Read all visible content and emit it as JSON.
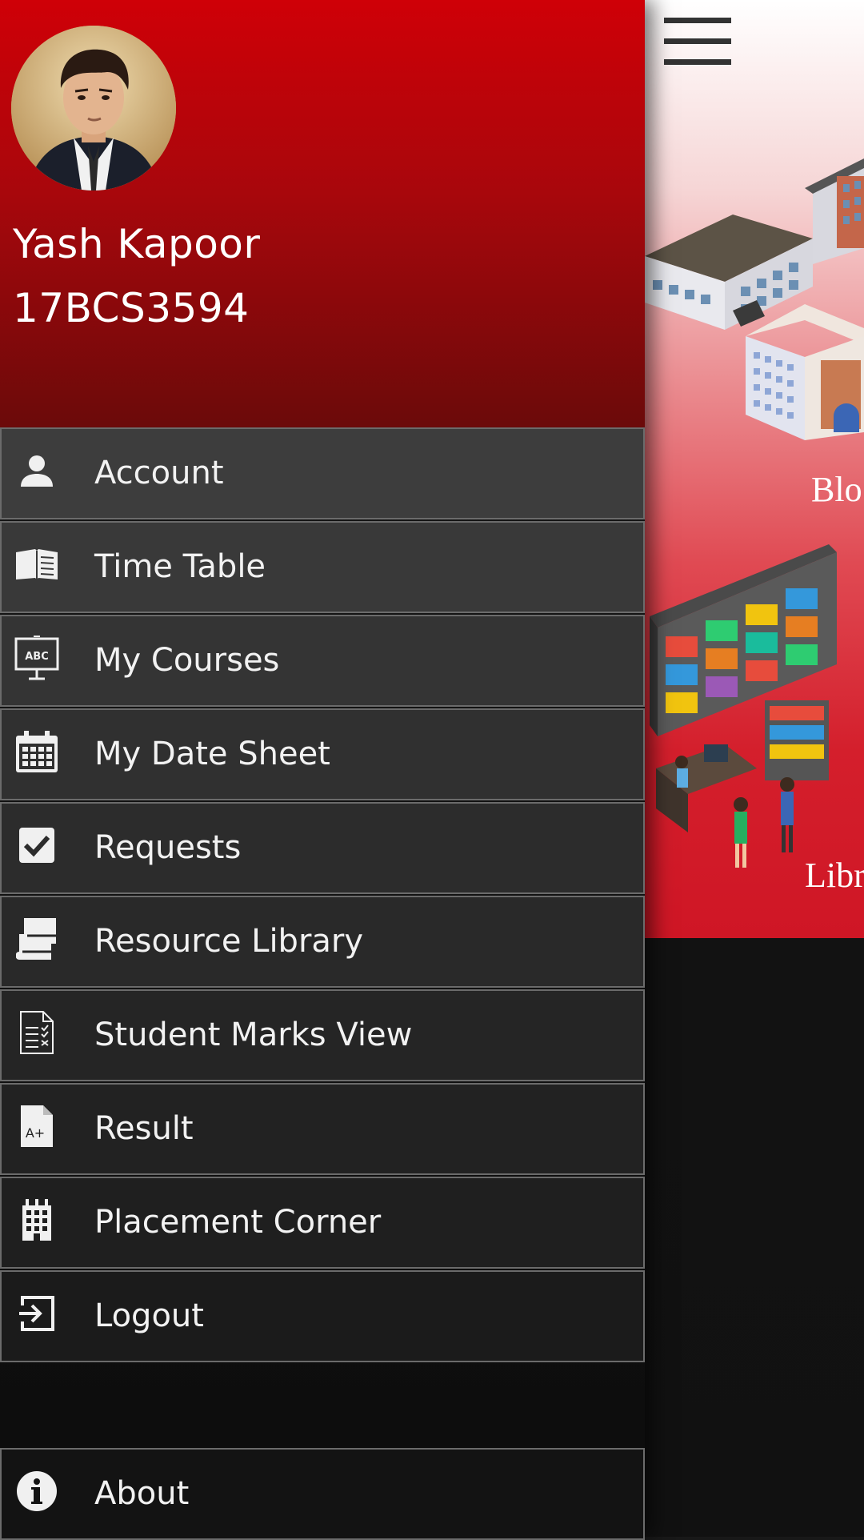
{
  "user": {
    "name": "Yash Kapoor",
    "roll_number": "17BCS3594"
  },
  "menu": [
    {
      "label": "Account",
      "icon": "person-icon"
    },
    {
      "label": "Time Table",
      "icon": "open-book-icon"
    },
    {
      "label": "My Courses",
      "icon": "abc-board-icon"
    },
    {
      "label": "My Date Sheet",
      "icon": "calendar-icon"
    },
    {
      "label": "Requests",
      "icon": "checkbox-icon"
    },
    {
      "label": "Resource Library",
      "icon": "books-icon"
    },
    {
      "label": "Student Marks View",
      "icon": "checklist-document-icon"
    },
    {
      "label": "Result",
      "icon": "grade-document-icon"
    },
    {
      "label": "Placement Corner",
      "icon": "building-icon"
    },
    {
      "label": "Logout",
      "icon": "logout-icon"
    }
  ],
  "about": {
    "label": "About",
    "icon": "info-icon"
  },
  "main": {
    "categories": [
      "Blo",
      "Libr"
    ]
  },
  "colors": {
    "header_top": "#cf0007",
    "header_bottom": "#6b0a0a",
    "menu_border": "#6b6b6b",
    "menu_text": "#f2f2f2",
    "banner_red": "#cf1625"
  }
}
